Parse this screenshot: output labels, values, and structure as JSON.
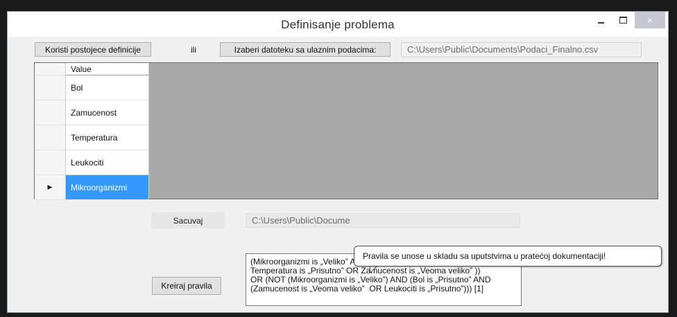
{
  "window": {
    "title": "Definisanje problema",
    "close_glyph": "×"
  },
  "toolbar": {
    "use_existing_label": "Koristi postojece definicije",
    "or_label": "ili",
    "choose_file_label": "Izaberi datoteku sa ulaznim podacima:",
    "input_file_path": "C:\\Users\\Public\\Documents\\Podaci_Finalno.csv"
  },
  "grid": {
    "column_header": "Value",
    "rows": [
      {
        "value": "Bol",
        "current": false
      },
      {
        "value": "Zamucenost",
        "current": false
      },
      {
        "value": "Temperatura",
        "current": false
      },
      {
        "value": "Leukociti",
        "current": false
      },
      {
        "value": "Mikroorganizmi",
        "current": true
      }
    ],
    "current_row_glyph": "▶"
  },
  "save": {
    "button_label": "Sacuvaj",
    "path_visible": "C:\\Users\\Public\\Docume"
  },
  "rules": {
    "button_label": "Kreiraj pravila",
    "text": "(Mikroorganizmi is „Veliko” AND (Bol is „Prisutno” OR\nTemperatura is „Prisutno” OR Zamucenost is „Veoma veliko” ))\nOR (NOT (Mikroorganizmi is „Veliko”) AND (Bol is „Prisutno” AND\n(Zamucenost is „Veoma veliko”  OR Leukociti is „Prisutno”))) [1]",
    "tooltip": "Pravila se unose u skladu sa uputstvima u pratećoj dokumentaciji!"
  },
  "colors": {
    "selection": "#3399ff",
    "grid_background": "#a9a9a9",
    "window_background": "#f0f0f0"
  }
}
